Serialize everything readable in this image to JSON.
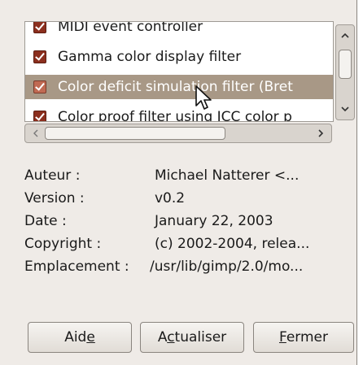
{
  "plugin_list": {
    "items": [
      {
        "label": "MIDI event controller",
        "checked": true,
        "selected": false
      },
      {
        "label": "Gamma color display filter",
        "checked": true,
        "selected": false
      },
      {
        "label": "Color deficit simulation filter (Bret",
        "checked": true,
        "selected": true
      },
      {
        "label": "Color proof filter using ICC color p",
        "checked": true,
        "selected": false
      }
    ]
  },
  "details": {
    "author_label": "Auteur :",
    "author_value": "Michael Natterer <...",
    "version_label": "Version :",
    "version_value": "v0.2",
    "date_label": "Date :",
    "date_value": "January 22, 2003",
    "copyright_label": "Copyright :",
    "copyright_value": "(c) 2002-2004, relea...",
    "location_label": "Emplacement :",
    "location_value": "/usr/lib/gimp/2.0/mo..."
  },
  "buttons": {
    "help_pre": "Aid",
    "help_mn": "e",
    "help_post": "",
    "refresh_pre": "A",
    "refresh_mn": "c",
    "refresh_post": "tualiser",
    "close_pre": "",
    "close_mn": "F",
    "close_post": "ermer"
  },
  "icons": {
    "scroll_up": "chevron-up-icon",
    "scroll_down": "chevron-down-icon",
    "scroll_left": "chevron-left-icon",
    "scroll_right": "chevron-right-icon",
    "pointer": "mouse-pointer-icon",
    "checkbox": "checkmark-icon"
  },
  "colors": {
    "dialog_bg": "#efebe7",
    "selection_bg": "#a89886",
    "checkbox": "#8c2f1e"
  }
}
